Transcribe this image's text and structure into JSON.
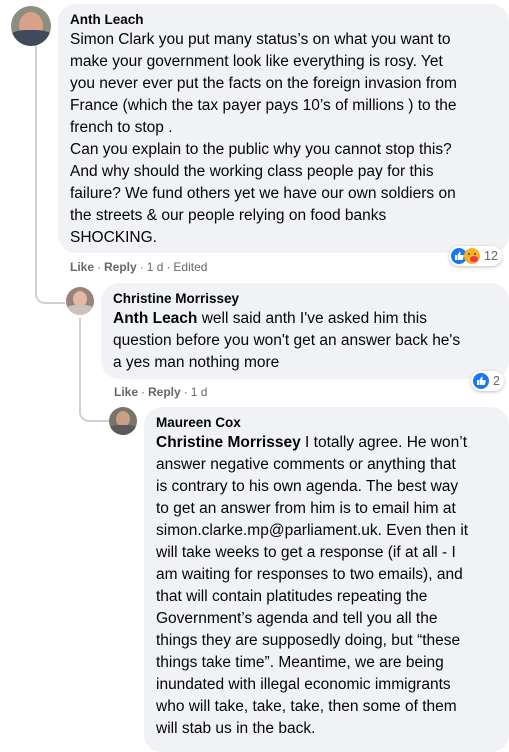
{
  "comments": [
    {
      "author": "Anth Leach",
      "mention": "",
      "text": "Simon Clark you put many status’s on what you want to\nmake your government look like everything is rosy. Yet\nyou never ever put the facts on the foreign invasion from\nFrance (which the tax payer pays 10’s of millions ) to the\nfrench to stop .\nCan you explain to the public why you cannot stop this?\nAnd why should the working class people pay for this\nfailure? We fund others yet we have our own soldiers on\nthe streets & our people relying on food banks\nSHOCKING.",
      "like_label": "Like",
      "reply_label": "Reply",
      "time": "1 d",
      "edited": "Edited",
      "reaction_count": "12"
    },
    {
      "author": "Christine Morrissey",
      "mention": "Anth Leach",
      "text": " well said anth I've asked him this\nquestion before you won't get an answer back he's\na yes man nothing more",
      "like_label": "Like",
      "reply_label": "Reply",
      "time": "1 d",
      "reaction_count": "2"
    },
    {
      "author": "Maureen Cox",
      "mention": "Christine Morrissey",
      "text": " I totally agree. He won’t\nanswer negative comments or anything that\nis contrary to his own agenda. The best way\nto get an answer from him is to email him at\nsimon.clarke.mp@parliament.uk. Even then it\nwill take weeks to get a response (if at all - I\nam waiting for responses to two emails), and\nthat will contain platitudes repeating the\nGovernment’s agenda and tell you all the\nthings they are supposedly doing, but “these\nthings take time”. Meantime, we are being\ninundated with illegal economic immigrants\nwho will take, take, take, then some of them\nwill stab us in the back."
    }
  ],
  "separator": "·",
  "icons": {
    "like": "thumbs-up-icon",
    "care": "care-reaction-icon"
  },
  "colors": {
    "bubble": "#f0f2f5",
    "meta": "#65676b",
    "like": "#1877f2",
    "thread": "#ced0d4"
  }
}
